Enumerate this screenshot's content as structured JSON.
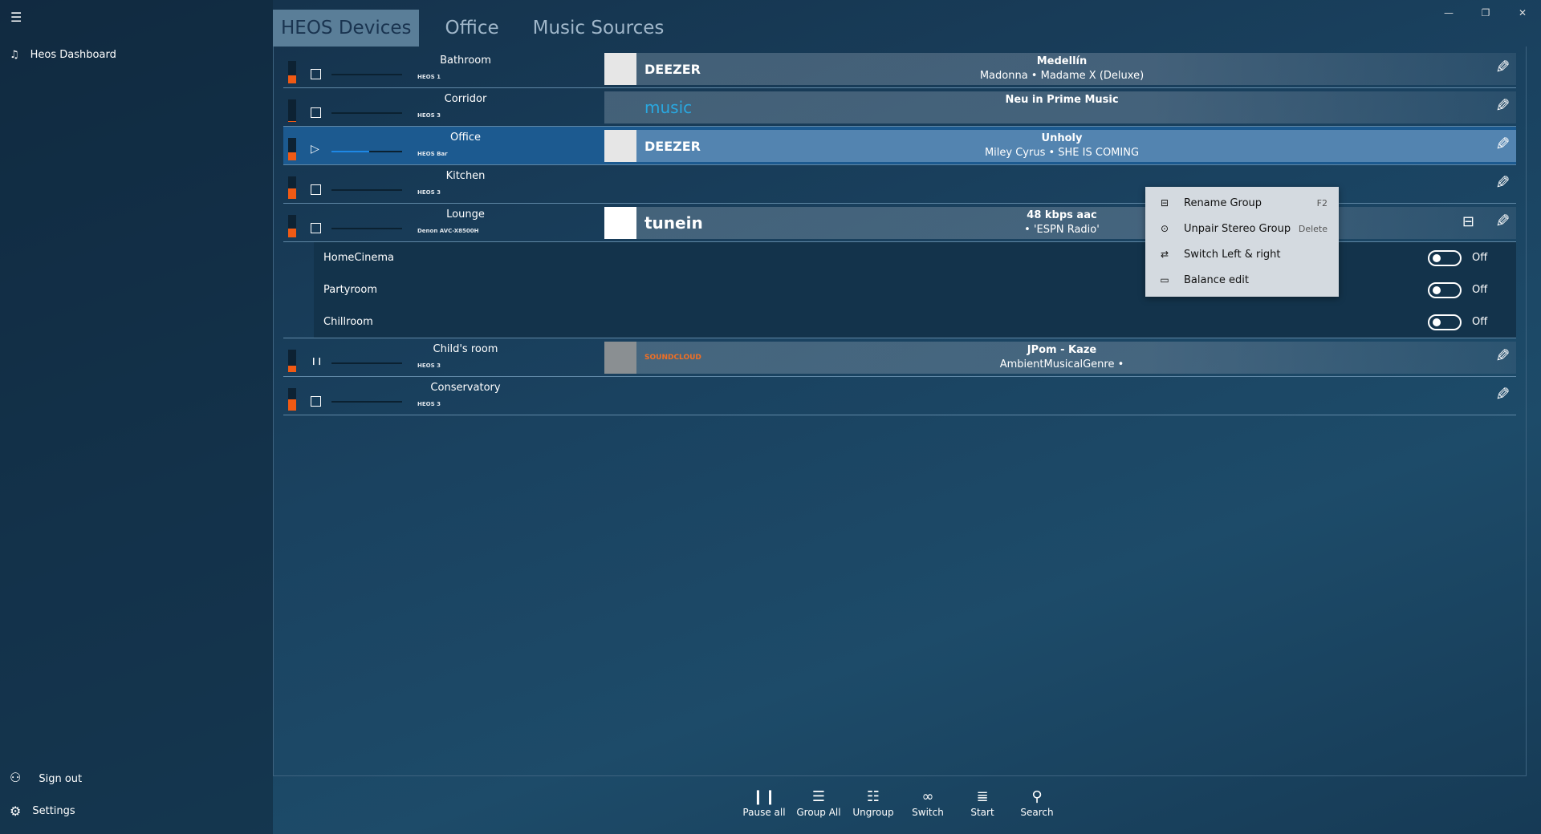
{
  "sidebar": {
    "title": "Heos Dashboard",
    "sign_out": "Sign out",
    "settings": "Settings"
  },
  "tabs": [
    "HEOS Devices",
    "Office",
    "Music Sources"
  ],
  "rows": [
    {
      "name": "Bathroom",
      "model": "HEOS 1",
      "volume": 0.35,
      "state": "stopped",
      "source": "DEEZER",
      "title": "Medellín",
      "subtitle": "Madonna • Madame X (Deluxe)"
    },
    {
      "name": "Corridor",
      "model": "HEOS 3",
      "volume": 0.05,
      "state": "stopped",
      "source": "music",
      "title": "Neu in Prime Music",
      "subtitle": ""
    },
    {
      "name": "Office",
      "model": "HEOS Bar",
      "volume": 0.35,
      "state": "paused",
      "progress": 0.53,
      "source": "DEEZER",
      "title": "Unholy",
      "subtitle": "Miley Cyrus • SHE IS COMING"
    },
    {
      "name": "Kitchen",
      "model": "HEOS 3",
      "volume": 0.45,
      "state": "stopped",
      "source": "",
      "title": "",
      "subtitle": ""
    },
    {
      "name": "Lounge",
      "model": "Denon AVC-X8500H",
      "volume": 0.4,
      "state": "stopped",
      "source": "tunein",
      "title": "48 kbps aac",
      "subtitle": "• 'ESPN Radio'"
    }
  ],
  "subrows": [
    {
      "name": "HomeCinema",
      "toggle": "Off"
    },
    {
      "name": "Partyroom",
      "toggle": "Off"
    },
    {
      "name": "Chillroom",
      "toggle": "Off"
    }
  ],
  "rows2": [
    {
      "name": "Child's room",
      "model": "HEOS 3",
      "volume": 0.3,
      "state": "playing",
      "source": "SOUNDCLOUD",
      "title": "JPom - Kaze",
      "subtitle": "AmbientMusicalGenre •"
    },
    {
      "name": "Conservatory",
      "model": "HEOS 3",
      "volume": 0.5,
      "state": "stopped",
      "source": "",
      "title": "",
      "subtitle": ""
    }
  ],
  "menu": [
    {
      "label": "Rename Group",
      "shortcut": "F2",
      "icon": "rename-icon"
    },
    {
      "label": "Unpair Stereo Group",
      "shortcut": "Delete",
      "icon": "speaker-icon"
    },
    {
      "label": "Switch Left & right",
      "shortcut": "",
      "icon": "swap-icon"
    },
    {
      "label": "Balance edit",
      "shortcut": "",
      "icon": "balance-icon"
    }
  ],
  "toolbar": [
    "Pause all",
    "Group All",
    "Ungroup",
    "Switch",
    "Start",
    "Search"
  ],
  "colors": {
    "accent": "#1e88e5",
    "volume": "#f05a14",
    "selected_row": "#1c5a90"
  }
}
